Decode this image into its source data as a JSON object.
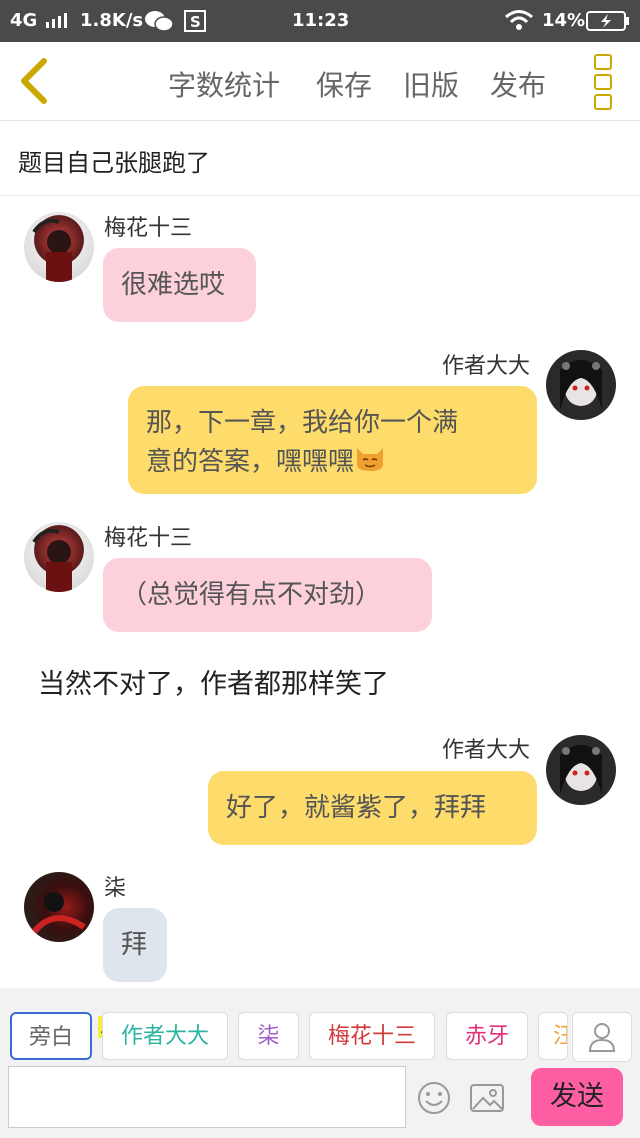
{
  "status_bar": {
    "network": "4G",
    "speed": "1.8K/s",
    "time": "11:23",
    "battery": "14%"
  },
  "toolbar": {
    "word_count": "字数统计",
    "save": "保存",
    "old_version": "旧版",
    "publish": "发布"
  },
  "topic": {
    "title": "题目自己张腿跑了"
  },
  "messages": [
    {
      "sender": "梅花十三",
      "text": "很难选哎"
    },
    {
      "sender": "作者大大",
      "text_line1": "那，下一章，我给你一个满",
      "text_line2": "意的答案，嘿嘿嘿"
    },
    {
      "sender": "梅花十三",
      "text": "（总觉得有点不对劲）"
    },
    {
      "narration": "当然不对了，作者都那样笑了"
    },
    {
      "sender": "作者大大",
      "text": "好了，就酱紫了，拜拜"
    },
    {
      "sender": "柒",
      "text": "拜"
    }
  ],
  "roles": {
    "main_badge": "主",
    "items": [
      {
        "label": "旁白",
        "color": "#666666"
      },
      {
        "label": "作者大大",
        "color": "#2bb3a3"
      },
      {
        "label": "柒",
        "color": "#a05cc8"
      },
      {
        "label": "梅花十三",
        "color": "#d23a3a"
      },
      {
        "label": "赤牙",
        "color": "#e0327a"
      },
      {
        "label": "汪",
        "color": "#f0a040"
      }
    ]
  },
  "composer": {
    "send_label": "发送",
    "placeholder": ""
  },
  "colors": {
    "pink_bubble": "#fcd1dc",
    "yellow_bubble": "#fddc6b",
    "grey_bubble": "#dfe5ec",
    "send_button": "#ff5fa2",
    "accent": "#c9a800"
  }
}
